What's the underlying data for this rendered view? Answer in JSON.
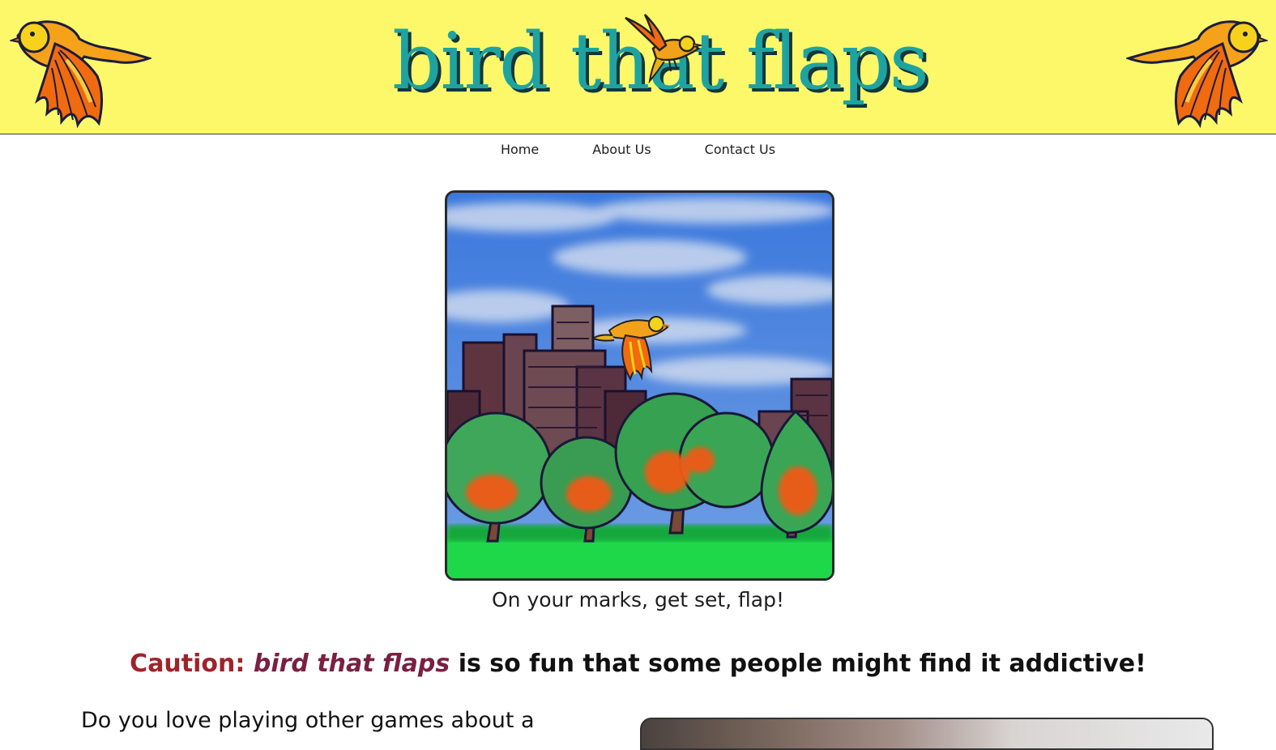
{
  "site": {
    "title": "bird that flaps"
  },
  "nav": {
    "items": [
      {
        "label": "Home"
      },
      {
        "label": "About Us"
      },
      {
        "label": "Contact Us"
      }
    ]
  },
  "hero": {
    "caption": "On your marks, get set, flap!"
  },
  "caution": {
    "label": "Caution:",
    "brand": "bird that flaps",
    "message": "is so fun that some people might find it addictive!"
  },
  "intro": {
    "text": "Do you love playing other games about a"
  },
  "colors": {
    "banner_background": "#fdf86a",
    "logo_teal": "#1ea3a0",
    "logo_shadow": "#13363a",
    "caution_red": "#a0232a",
    "brand_maroon": "#7a2040"
  },
  "icons": {
    "banner_left": "flying-bird-icon",
    "banner_right": "flying-bird-icon",
    "logo_bird": "bird-icon"
  }
}
